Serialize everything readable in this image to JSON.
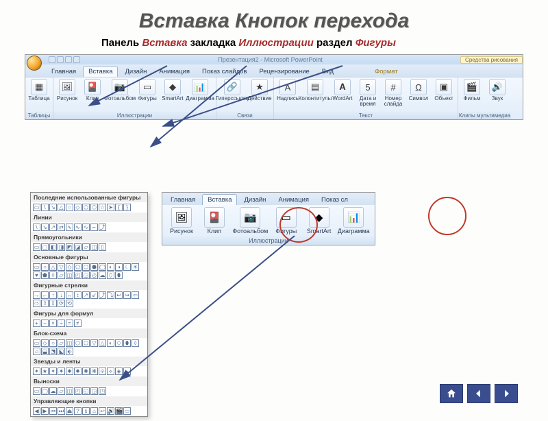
{
  "slide": {
    "title": "Вставка Кнопок перехода",
    "subtitle_parts": {
      "p1": "Панель ",
      "p2": "Вставка ",
      "p3": "закладка ",
      "p4": "Иллюстрации ",
      "p5": "раздел ",
      "p6": "Фигуры"
    }
  },
  "ribbon": {
    "window_caption": "Презентация2 - Microsoft PowerPoint",
    "tool_context": "Средства рисования",
    "tabs": {
      "home": "Главная",
      "insert": "Вставка",
      "design": "Дизайн",
      "anim": "Анимация",
      "show": "Показ слайдов",
      "review": "Рецензирование",
      "view": "Вид",
      "format": "Формат"
    },
    "groups": {
      "tables": {
        "label": "Таблицы",
        "items": {
          "table": "Таблица"
        }
      },
      "illus": {
        "label": "Иллюстрации",
        "items": {
          "picture": "Рисунок",
          "clip": "Клип",
          "album": "Фотоальбом",
          "shapes": "Фигуры",
          "smartart": "SmartArt",
          "chart": "Диаграмма"
        }
      },
      "links": {
        "label": "Связи",
        "items": {
          "hyperlink": "Гиперссылка",
          "action": "Действие"
        }
      },
      "text": {
        "label": "Текст",
        "items": {
          "textbox": "Надпись",
          "headfoot": "Колонтитулы",
          "wordart": "WordArt",
          "datetime": "Дата и время",
          "slidenum": "Номер слайда",
          "symbol": "Символ",
          "object": "Объект"
        }
      },
      "media": {
        "label": "Клипы мультимедиа",
        "items": {
          "movie": "Фильм",
          "sound": "Звук"
        }
      }
    }
  },
  "zoom": {
    "tabs": {
      "home": "Главная",
      "insert": "Вставка",
      "design": "Дизайн",
      "anim": "Анимация",
      "show": "Показ сл"
    },
    "items": {
      "picture": "Рисунок",
      "clip": "Клип",
      "album": "Фотоальбом",
      "shapes": "Фигуры",
      "smartart": "SmartArt",
      "chart": "Диаграмма"
    },
    "group_label": "Иллюстрации"
  },
  "gallery": {
    "recent": "Последние использованные фигуры",
    "lines": "Линии",
    "rects": "Прямоугольники",
    "basic": "Основные фигуры",
    "arrows": "Фигурные стрелки",
    "equation": "Фигуры для формул",
    "flow": "Блок-схема",
    "stars": "Звезды и ленты",
    "callouts": "Выноски",
    "action": "Управляющие кнопки"
  },
  "nav": {
    "home_icon": "home-icon",
    "back_icon": "back-icon",
    "forward_icon": "forward-icon"
  }
}
